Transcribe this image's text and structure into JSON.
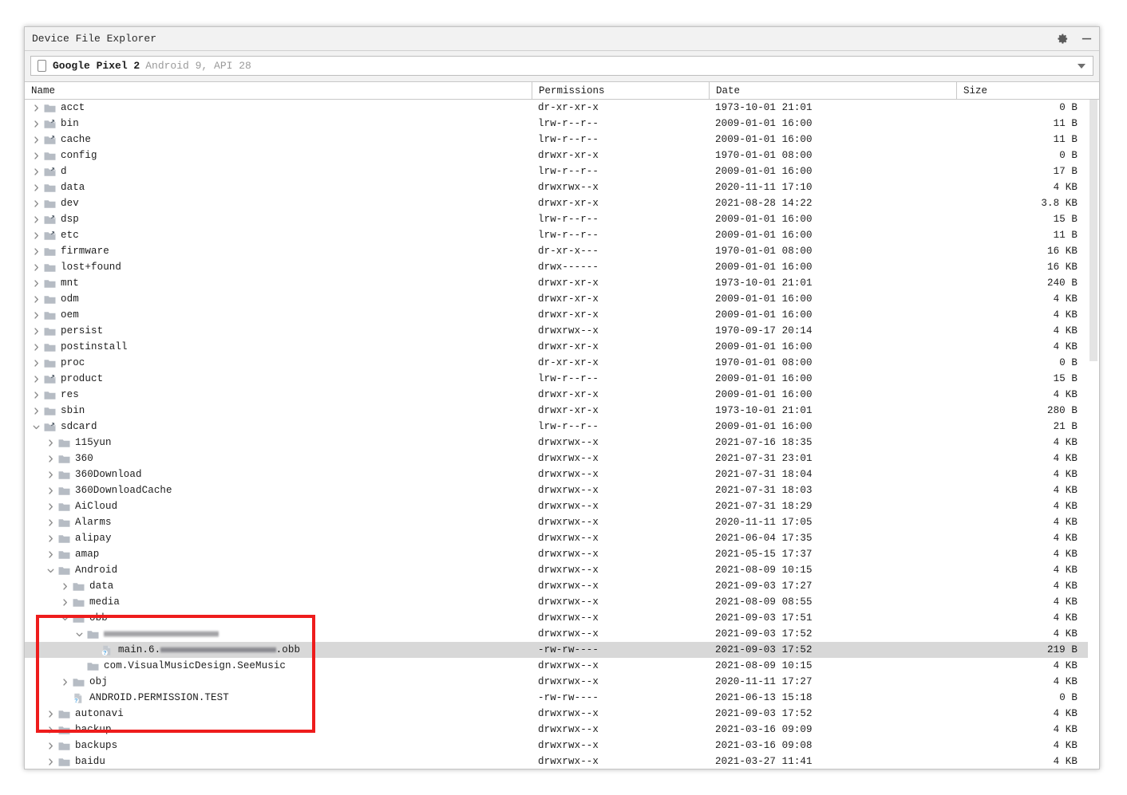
{
  "window": {
    "title": "Device File Explorer",
    "settings_icon": "gear-icon",
    "minimize_icon": "minimize-icon"
  },
  "device_selector": {
    "icon": "phone-icon",
    "name": "Google Pixel 2",
    "meta": "Android 9, API 28",
    "dropdown_icon": "chevron-down-icon"
  },
  "columns": {
    "name": "Name",
    "permissions": "Permissions",
    "date": "Date",
    "size": "Size"
  },
  "rows": [
    {
      "name": "acct",
      "indent": 0,
      "chevron": "right",
      "icon": "folder",
      "permissions": "dr-xr-xr-x",
      "date": "1973-10-01 21:01",
      "size": "0 B",
      "selected": false
    },
    {
      "name": "bin",
      "indent": 0,
      "chevron": "right",
      "icon": "folder-link",
      "permissions": "lrw-r--r--",
      "date": "2009-01-01 16:00",
      "size": "11 B",
      "selected": false
    },
    {
      "name": "cache",
      "indent": 0,
      "chevron": "right",
      "icon": "folder-link",
      "permissions": "lrw-r--r--",
      "date": "2009-01-01 16:00",
      "size": "11 B",
      "selected": false
    },
    {
      "name": "config",
      "indent": 0,
      "chevron": "right",
      "icon": "folder",
      "permissions": "drwxr-xr-x",
      "date": "1970-01-01 08:00",
      "size": "0 B",
      "selected": false
    },
    {
      "name": "d",
      "indent": 0,
      "chevron": "right",
      "icon": "folder-link",
      "permissions": "lrw-r--r--",
      "date": "2009-01-01 16:00",
      "size": "17 B",
      "selected": false
    },
    {
      "name": "data",
      "indent": 0,
      "chevron": "right",
      "icon": "folder",
      "permissions": "drwxrwx--x",
      "date": "2020-11-11 17:10",
      "size": "4 KB",
      "selected": false
    },
    {
      "name": "dev",
      "indent": 0,
      "chevron": "right",
      "icon": "folder",
      "permissions": "drwxr-xr-x",
      "date": "2021-08-28 14:22",
      "size": "3.8 KB",
      "selected": false
    },
    {
      "name": "dsp",
      "indent": 0,
      "chevron": "right",
      "icon": "folder-link",
      "permissions": "lrw-r--r--",
      "date": "2009-01-01 16:00",
      "size": "15 B",
      "selected": false
    },
    {
      "name": "etc",
      "indent": 0,
      "chevron": "right",
      "icon": "folder-link",
      "permissions": "lrw-r--r--",
      "date": "2009-01-01 16:00",
      "size": "11 B",
      "selected": false
    },
    {
      "name": "firmware",
      "indent": 0,
      "chevron": "right",
      "icon": "folder",
      "permissions": "dr-xr-x---",
      "date": "1970-01-01 08:00",
      "size": "16 KB",
      "selected": false
    },
    {
      "name": "lost+found",
      "indent": 0,
      "chevron": "right",
      "icon": "folder",
      "permissions": "drwx------",
      "date": "2009-01-01 16:00",
      "size": "16 KB",
      "selected": false
    },
    {
      "name": "mnt",
      "indent": 0,
      "chevron": "right",
      "icon": "folder",
      "permissions": "drwxr-xr-x",
      "date": "1973-10-01 21:01",
      "size": "240 B",
      "selected": false
    },
    {
      "name": "odm",
      "indent": 0,
      "chevron": "right",
      "icon": "folder",
      "permissions": "drwxr-xr-x",
      "date": "2009-01-01 16:00",
      "size": "4 KB",
      "selected": false
    },
    {
      "name": "oem",
      "indent": 0,
      "chevron": "right",
      "icon": "folder",
      "permissions": "drwxr-xr-x",
      "date": "2009-01-01 16:00",
      "size": "4 KB",
      "selected": false
    },
    {
      "name": "persist",
      "indent": 0,
      "chevron": "right",
      "icon": "folder",
      "permissions": "drwxrwx--x",
      "date": "1970-09-17 20:14",
      "size": "4 KB",
      "selected": false
    },
    {
      "name": "postinstall",
      "indent": 0,
      "chevron": "right",
      "icon": "folder",
      "permissions": "drwxr-xr-x",
      "date": "2009-01-01 16:00",
      "size": "4 KB",
      "selected": false
    },
    {
      "name": "proc",
      "indent": 0,
      "chevron": "right",
      "icon": "folder",
      "permissions": "dr-xr-xr-x",
      "date": "1970-01-01 08:00",
      "size": "0 B",
      "selected": false
    },
    {
      "name": "product",
      "indent": 0,
      "chevron": "right",
      "icon": "folder-link",
      "permissions": "lrw-r--r--",
      "date": "2009-01-01 16:00",
      "size": "15 B",
      "selected": false
    },
    {
      "name": "res",
      "indent": 0,
      "chevron": "right",
      "icon": "folder",
      "permissions": "drwxr-xr-x",
      "date": "2009-01-01 16:00",
      "size": "4 KB",
      "selected": false
    },
    {
      "name": "sbin",
      "indent": 0,
      "chevron": "right",
      "icon": "folder",
      "permissions": "drwxr-xr-x",
      "date": "1973-10-01 21:01",
      "size": "280 B",
      "selected": false
    },
    {
      "name": "sdcard",
      "indent": 0,
      "chevron": "down",
      "icon": "folder-link",
      "permissions": "lrw-r--r--",
      "date": "2009-01-01 16:00",
      "size": "21 B",
      "selected": false
    },
    {
      "name": "115yun",
      "indent": 1,
      "chevron": "right",
      "icon": "folder",
      "permissions": "drwxrwx--x",
      "date": "2021-07-16 18:35",
      "size": "4 KB",
      "selected": false
    },
    {
      "name": "360",
      "indent": 1,
      "chevron": "right",
      "icon": "folder",
      "permissions": "drwxrwx--x",
      "date": "2021-07-31 23:01",
      "size": "4 KB",
      "selected": false
    },
    {
      "name": "360Download",
      "indent": 1,
      "chevron": "right",
      "icon": "folder",
      "permissions": "drwxrwx--x",
      "date": "2021-07-31 18:04",
      "size": "4 KB",
      "selected": false
    },
    {
      "name": "360DownloadCache",
      "indent": 1,
      "chevron": "right",
      "icon": "folder",
      "permissions": "drwxrwx--x",
      "date": "2021-07-31 18:03",
      "size": "4 KB",
      "selected": false
    },
    {
      "name": "AiCloud",
      "indent": 1,
      "chevron": "right",
      "icon": "folder",
      "permissions": "drwxrwx--x",
      "date": "2021-07-31 18:29",
      "size": "4 KB",
      "selected": false
    },
    {
      "name": "Alarms",
      "indent": 1,
      "chevron": "right",
      "icon": "folder",
      "permissions": "drwxrwx--x",
      "date": "2020-11-11 17:05",
      "size": "4 KB",
      "selected": false
    },
    {
      "name": "alipay",
      "indent": 1,
      "chevron": "right",
      "icon": "folder",
      "permissions": "drwxrwx--x",
      "date": "2021-06-04 17:35",
      "size": "4 KB",
      "selected": false
    },
    {
      "name": "amap",
      "indent": 1,
      "chevron": "right",
      "icon": "folder",
      "permissions": "drwxrwx--x",
      "date": "2021-05-15 17:37",
      "size": "4 KB",
      "selected": false
    },
    {
      "name": "Android",
      "indent": 1,
      "chevron": "down",
      "icon": "folder",
      "permissions": "drwxrwx--x",
      "date": "2021-08-09 10:15",
      "size": "4 KB",
      "selected": false
    },
    {
      "name": "data",
      "indent": 2,
      "chevron": "right",
      "icon": "folder",
      "permissions": "drwxrwx--x",
      "date": "2021-09-03 17:27",
      "size": "4 KB",
      "selected": false
    },
    {
      "name": "media",
      "indent": 2,
      "chevron": "right",
      "icon": "folder",
      "permissions": "drwxrwx--x",
      "date": "2021-08-09 08:55",
      "size": "4 KB",
      "selected": false
    },
    {
      "name": "obb",
      "indent": 2,
      "chevron": "down",
      "icon": "folder",
      "permissions": "drwxrwx--x",
      "date": "2021-09-03 17:51",
      "size": "4 KB",
      "selected": false
    },
    {
      "name": "",
      "name_redacted": "com.xxxxxx.xxxxxxxx",
      "indent": 3,
      "chevron": "down",
      "icon": "folder",
      "permissions": "drwxrwx--x",
      "date": "2021-09-03 17:52",
      "size": "4 KB",
      "selected": false
    },
    {
      "name_prefix": "main.6.",
      "name_redacted": "xxx.xxxxxxx.xxxxxxx",
      "name_suffix": ".obb",
      "indent": 4,
      "chevron": "none",
      "icon": "file-unknown",
      "permissions": "-rw-rw----",
      "date": "2021-09-03 17:52",
      "size": "219 B",
      "selected": true
    },
    {
      "name": "com.VisualMusicDesign.SeeMusic",
      "indent": 3,
      "chevron": "none",
      "icon": "folder",
      "permissions": "drwxrwx--x",
      "date": "2021-08-09 10:15",
      "size": "4 KB",
      "selected": false
    },
    {
      "name": "obj",
      "indent": 2,
      "chevron": "right",
      "icon": "folder",
      "permissions": "drwxrwx--x",
      "date": "2020-11-11 17:27",
      "size": "4 KB",
      "selected": false
    },
    {
      "name": "ANDROID.PERMISSION.TEST",
      "indent": 2,
      "chevron": "none",
      "icon": "file-unknown",
      "permissions": "-rw-rw----",
      "date": "2021-06-13 15:18",
      "size": "0 B",
      "selected": false
    },
    {
      "name": "autonavi",
      "indent": 1,
      "chevron": "right",
      "icon": "folder",
      "permissions": "drwxrwx--x",
      "date": "2021-09-03 17:52",
      "size": "4 KB",
      "selected": false
    },
    {
      "name": "backup",
      "indent": 1,
      "chevron": "right",
      "icon": "folder",
      "permissions": "drwxrwx--x",
      "date": "2021-03-16 09:09",
      "size": "4 KB",
      "selected": false
    },
    {
      "name": "backups",
      "indent": 1,
      "chevron": "right",
      "icon": "folder",
      "permissions": "drwxrwx--x",
      "date": "2021-03-16 09:08",
      "size": "4 KB",
      "selected": false
    },
    {
      "name": "baidu",
      "indent": 1,
      "chevron": "right",
      "icon": "folder",
      "permissions": "drwxrwx--x",
      "date": "2021-03-27 11:41",
      "size": "4 KB",
      "selected": false
    }
  ],
  "annotation": {
    "shape": "rectangle",
    "color": "#ee1c1c"
  },
  "scrollbar": {
    "orientation": "vertical",
    "thumb_color": "#e4e4e4"
  }
}
